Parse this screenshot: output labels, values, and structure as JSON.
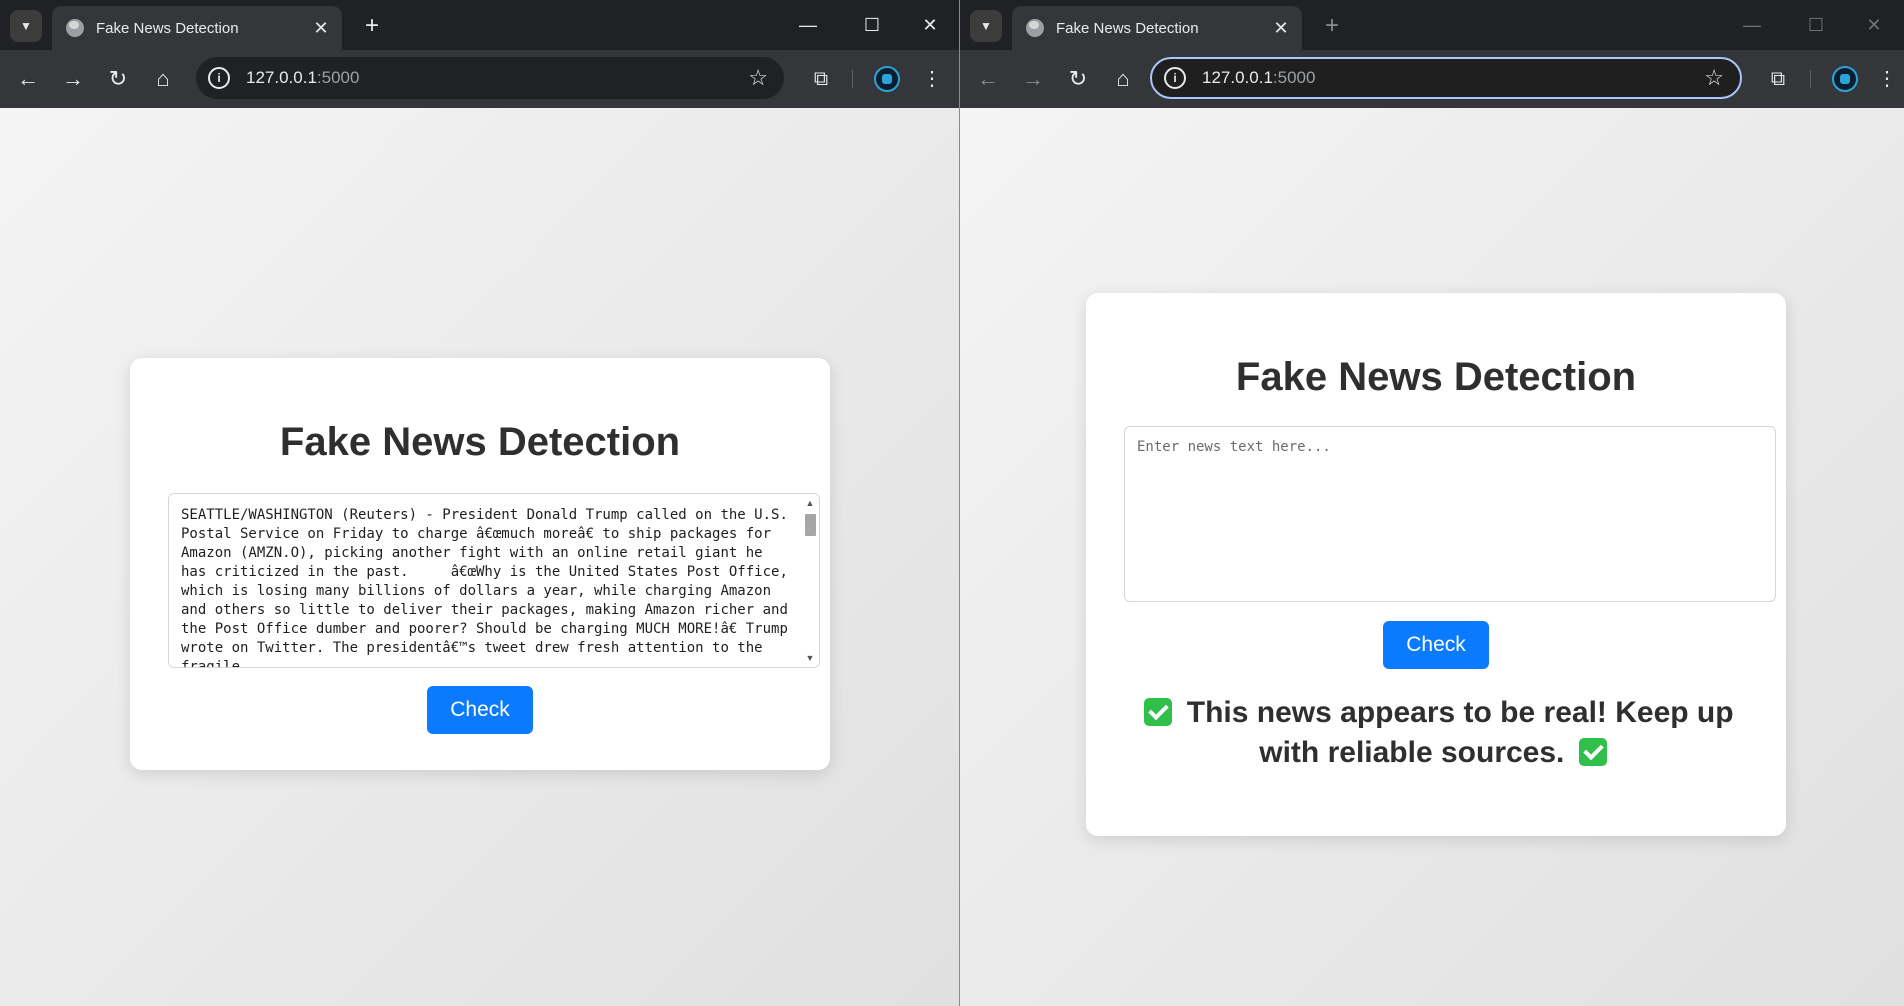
{
  "left": {
    "tab_title": "Fake News Detection",
    "url_host": "127.0.0.1",
    "url_port": ":5000",
    "heading": "Fake News Detection",
    "news_text": "SEATTLE/WASHINGTON (Reuters) - President Donald Trump called on the U.S. Postal Service on Friday to charge â€œmuch moreâ€ to ship packages for Amazon (AMZN.O), picking another fight with an online retail giant he has criticized in the past.     â€œWhy is the United States Post Office, which is losing many billions of dollars a year, while charging Amazon and others so little to deliver their packages, making Amazon richer and the Post Office dumber and poorer? Should be charging MUCH MORE!â€ Trump wrote on Twitter. The presidentâ€™s tweet drew fresh attention to the fragile",
    "check_label": "Check"
  },
  "right": {
    "tab_title": "Fake News Detection",
    "url_host": "127.0.0.1",
    "url_port": ":5000",
    "heading": "Fake News Detection",
    "placeholder": "Enter news text here...",
    "check_label": "Check",
    "result_text": "This news appears to be real! Keep up with reliable sources."
  },
  "icons": {
    "tab_search": "chevron-down-icon",
    "favicon": "globe-icon",
    "close": "close-icon",
    "new_tab": "plus-icon",
    "back": "arrow-left-icon",
    "forward": "arrow-right-icon",
    "reload": "reload-icon",
    "home": "home-icon",
    "site_info": "info-icon",
    "bookmark": "star-icon",
    "extensions": "puzzle-icon",
    "menu": "kebab-menu-icon",
    "result_check": "check-mark-icon"
  },
  "colors": {
    "accent": "#0a7bff",
    "success": "#2fbf4a"
  }
}
